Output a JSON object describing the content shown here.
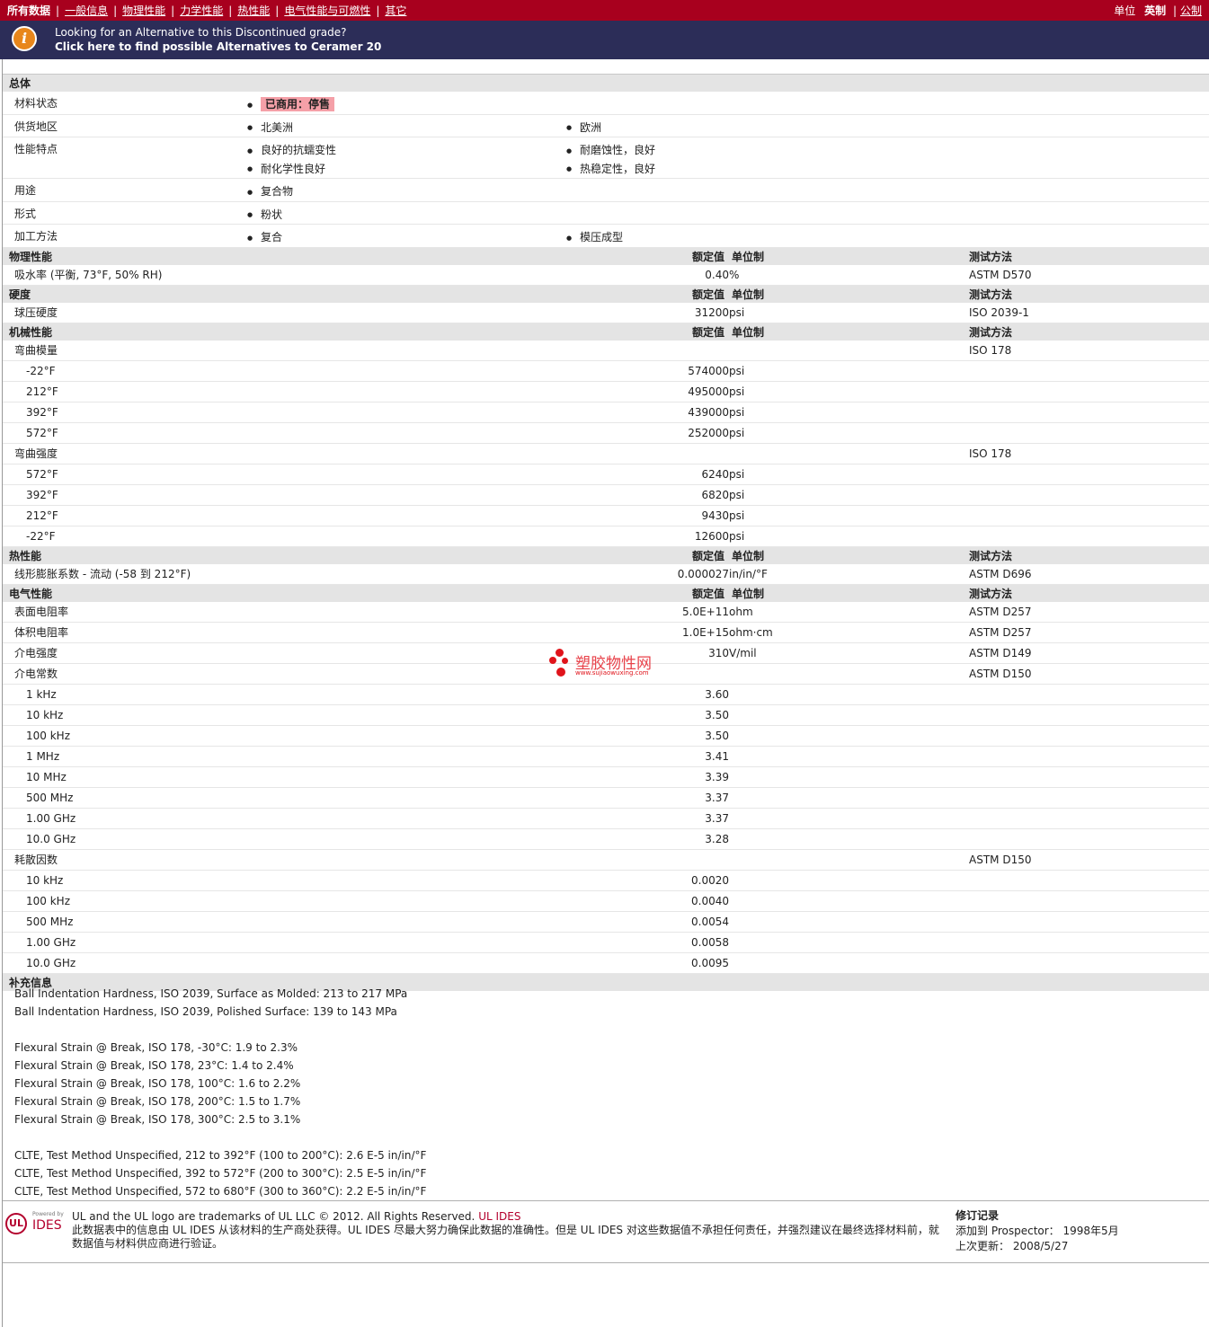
{
  "nav": {
    "tabs": [
      "所有数据",
      "一般信息",
      "物理性能",
      "力学性能",
      "热性能",
      "电气性能与可燃性",
      "其它"
    ],
    "units_label": "单位",
    "unit_english": "英制",
    "unit_metric": "公制"
  },
  "banner": {
    "line1": "Looking for an Alternative to this Discontinued grade?",
    "line2": "Click here to find possible Alternatives to Ceramer 20"
  },
  "headers": {
    "value": "额定值",
    "unit": "单位制",
    "method": "测试方法"
  },
  "general": {
    "title": "总体",
    "rows": [
      {
        "label": "材料状态",
        "col1": [
          "已商用：停售"
        ],
        "col2": []
      },
      {
        "label": "供货地区",
        "col1": [
          "北美洲"
        ],
        "col2": [
          "欧洲"
        ]
      },
      {
        "label": "性能特点",
        "col1": [
          "良好的抗蠕变性",
          "耐化学性良好"
        ],
        "col2": [
          "耐磨蚀性，良好",
          "热稳定性，良好"
        ]
      },
      {
        "label": "用途",
        "col1": [
          "复合物"
        ],
        "col2": []
      },
      {
        "label": "形式",
        "col1": [
          "粉状"
        ],
        "col2": []
      },
      {
        "label": "加工方法",
        "col1": [
          "复合"
        ],
        "col2": [
          "模压成型"
        ]
      }
    ]
  },
  "sections": [
    {
      "title": "物理性能",
      "rows": [
        {
          "name": "吸水率  (平衡, 73°F, 50% RH)",
          "value": "0.40",
          "unit": "%",
          "method": "ASTM D570"
        }
      ]
    },
    {
      "title": "硬度",
      "rows": [
        {
          "name": "球压硬度",
          "value": "31200",
          "unit": "psi",
          "method": "ISO 2039-1"
        }
      ]
    },
    {
      "title": "机械性能",
      "rows": [
        {
          "name": "弯曲模量",
          "value": "",
          "unit": "",
          "method": "ISO 178"
        },
        {
          "name": "-22°F",
          "value": "574000",
          "unit": "psi",
          "method": "",
          "sub": true
        },
        {
          "name": "212°F",
          "value": "495000",
          "unit": "psi",
          "method": "",
          "sub": true
        },
        {
          "name": "392°F",
          "value": "439000",
          "unit": "psi",
          "method": "",
          "sub": true
        },
        {
          "name": "572°F",
          "value": "252000",
          "unit": "psi",
          "method": "",
          "sub": true
        },
        {
          "name": "弯曲强度",
          "value": "",
          "unit": "",
          "method": "ISO 178"
        },
        {
          "name": "572°F",
          "value": "6240",
          "unit": "psi",
          "method": "",
          "sub": true
        },
        {
          "name": "392°F",
          "value": "6820",
          "unit": "psi",
          "method": "",
          "sub": true
        },
        {
          "name": "212°F",
          "value": "9430",
          "unit": "psi",
          "method": "",
          "sub": true
        },
        {
          "name": "-22°F",
          "value": "12600",
          "unit": "psi",
          "method": "",
          "sub": true
        }
      ]
    },
    {
      "title": "热性能",
      "rows": [
        {
          "name": "线形膨胀系数  - 流动  (-58 到  212°F)",
          "value": "0.000027",
          "unit": "in/in/°F",
          "method": "ASTM D696"
        }
      ]
    },
    {
      "title": "电气性能",
      "rows": [
        {
          "name": "表面电阻率",
          "value": "5.0E+11",
          "unit": "ohm",
          "method": "ASTM D257"
        },
        {
          "name": "体积电阻率",
          "value": "1.0E+15",
          "unit": "ohm·cm",
          "method": "ASTM D257"
        },
        {
          "name": "介电强度",
          "value": "310",
          "unit": "V/mil",
          "method": "ASTM D149"
        },
        {
          "name": "介电常数",
          "value": "",
          "unit": "",
          "method": "ASTM D150"
        },
        {
          "name": "1 kHz",
          "value": "3.60",
          "unit": "",
          "method": "",
          "sub": true
        },
        {
          "name": "10 kHz",
          "value": "3.50",
          "unit": "",
          "method": "",
          "sub": true
        },
        {
          "name": "100 kHz",
          "value": "3.50",
          "unit": "",
          "method": "",
          "sub": true
        },
        {
          "name": "1 MHz",
          "value": "3.41",
          "unit": "",
          "method": "",
          "sub": true
        },
        {
          "name": "10 MHz",
          "value": "3.39",
          "unit": "",
          "method": "",
          "sub": true
        },
        {
          "name": "500 MHz",
          "value": "3.37",
          "unit": "",
          "method": "",
          "sub": true
        },
        {
          "name": "1.00 GHz",
          "value": "3.37",
          "unit": "",
          "method": "",
          "sub": true
        },
        {
          "name": "10.0 GHz",
          "value": "3.28",
          "unit": "",
          "method": "",
          "sub": true
        },
        {
          "name": "耗散因数",
          "value": "",
          "unit": "",
          "method": "ASTM D150"
        },
        {
          "name": "10 kHz",
          "value": "0.0020",
          "unit": "",
          "method": "",
          "sub": true
        },
        {
          "name": "100 kHz",
          "value": "0.0040",
          "unit": "",
          "method": "",
          "sub": true
        },
        {
          "name": "500 MHz",
          "value": "0.0054",
          "unit": "",
          "method": "",
          "sub": true
        },
        {
          "name": "1.00 GHz",
          "value": "0.0058",
          "unit": "",
          "method": "",
          "sub": true
        },
        {
          "name": "10.0 GHz",
          "value": "0.0095",
          "unit": "",
          "method": "",
          "sub": true
        }
      ]
    }
  ],
  "supplement": {
    "title": "补充信息",
    "lines": [
      "Ball Indentation Hardness, ISO 2039, Surface as Molded: 213 to 217 MPa",
      "Ball Indentation Hardness, ISO 2039, Polished Surface: 139 to 143 MPa",
      "",
      "Flexural Strain @ Break, ISO 178, -30°C: 1.9 to 2.3%",
      "Flexural Strain @ Break, ISO 178, 23°C: 1.4 to 2.4%",
      "Flexural Strain @ Break, ISO 178, 100°C: 1.6 to 2.2%",
      "Flexural Strain @ Break, ISO 178, 200°C: 1.5 to 1.7%",
      "Flexural Strain @ Break, ISO 178, 300°C: 2.5 to 3.1%",
      "",
      "CLTE, Test Method Unspecified, 212 to 392°F (100 to 200°C): 2.6 E-5 in/in/°F",
      "CLTE, Test Method Unspecified, 392 to 572°F (200 to 300°C): 2.5 E-5 in/in/°F",
      "CLTE, Test Method Unspecified, 572 to 680°F (300 to 360°C): 2.2 E-5 in/in/°F"
    ]
  },
  "footer": {
    "logo_powered": "Powered by",
    "logo_ul": "UL",
    "logo_ides": "IDES",
    "trademark": "UL and the UL logo are trademarks of UL LLC © 2012. All Rights Reserved.",
    "ides_link": "UL IDES",
    "disclaimer": "此数据表中的信息由  UL IDES 从该材料的生产商处获得。UL IDES 尽最大努力确保此数据的准确性。但是  UL IDES 对这些数据值不承担任何责任，并强烈建议在最终选择材料前，就数据值与材料供应商进行验证。",
    "rev_title": "修订记录",
    "rev_added": "添加到  Prospector：  1998年5月",
    "rev_updated": "上次更新：   2008/5/27"
  },
  "watermark": {
    "cn": "塑胶物性网",
    "en": "www.sujiaowuxing.com"
  },
  "colors": {
    "nav_bg": "#a8001e",
    "banner_bg": "#2c2d58",
    "status_bg": "#f5a0a8",
    "section_bg": "#e4e4e4"
  }
}
